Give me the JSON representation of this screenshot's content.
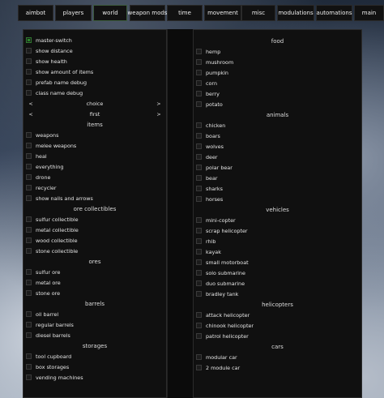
{
  "tabs": [
    "aimbot",
    "players",
    "world",
    "weapon mods",
    "time",
    "movement",
    "misc",
    "modulations",
    "automations",
    "main"
  ],
  "active_tab": "world",
  "left": [
    {
      "type": "checkbox",
      "label": "master-switch",
      "checked": true
    },
    {
      "type": "checkbox",
      "label": "show distance",
      "checked": false
    },
    {
      "type": "checkbox",
      "label": "show health",
      "checked": false
    },
    {
      "type": "checkbox",
      "label": "show amount of items",
      "checked": false
    },
    {
      "type": "checkbox",
      "label": "prefab name debug",
      "checked": false
    },
    {
      "type": "checkbox",
      "label": "class name debug",
      "checked": false
    },
    {
      "type": "select",
      "label": "choice",
      "prev": "<",
      "next": ">"
    },
    {
      "type": "select",
      "label": "first",
      "prev": "<",
      "next": ">"
    },
    {
      "type": "heading",
      "label": "items"
    },
    {
      "type": "checkbox",
      "label": "weapons",
      "checked": false
    },
    {
      "type": "checkbox",
      "label": "melee weapons",
      "checked": false
    },
    {
      "type": "checkbox",
      "label": "heal",
      "checked": false
    },
    {
      "type": "checkbox",
      "label": "everything",
      "checked": false
    },
    {
      "type": "checkbox",
      "label": "drone",
      "checked": false
    },
    {
      "type": "checkbox",
      "label": "recycler",
      "checked": false
    },
    {
      "type": "checkbox",
      "label": "show nails and arrows",
      "checked": false
    },
    {
      "type": "heading",
      "label": "ore collectibles"
    },
    {
      "type": "checkbox",
      "label": "sulfur collectible",
      "checked": false
    },
    {
      "type": "checkbox",
      "label": "metal collectible",
      "checked": false
    },
    {
      "type": "checkbox",
      "label": "wood collectible",
      "checked": false
    },
    {
      "type": "checkbox",
      "label": "stone collectible",
      "checked": false
    },
    {
      "type": "heading",
      "label": "ores"
    },
    {
      "type": "checkbox",
      "label": "sulfur ore",
      "checked": false
    },
    {
      "type": "checkbox",
      "label": "metal ore",
      "checked": false
    },
    {
      "type": "checkbox",
      "label": "stone ore",
      "checked": false
    },
    {
      "type": "heading",
      "label": "barrels"
    },
    {
      "type": "checkbox",
      "label": "oil barrel",
      "checked": false
    },
    {
      "type": "checkbox",
      "label": "regular barrels",
      "checked": false
    },
    {
      "type": "checkbox",
      "label": "diesel barrels",
      "checked": false
    },
    {
      "type": "heading",
      "label": "storages"
    },
    {
      "type": "checkbox",
      "label": "tool cupboard",
      "checked": false
    },
    {
      "type": "checkbox",
      "label": "box storages",
      "checked": false
    },
    {
      "type": "checkbox",
      "label": "vending machines",
      "checked": false
    }
  ],
  "right": [
    {
      "type": "heading",
      "label": "food"
    },
    {
      "type": "checkbox",
      "label": "hemp",
      "checked": false
    },
    {
      "type": "checkbox",
      "label": "mushroom",
      "checked": false
    },
    {
      "type": "checkbox",
      "label": "pumpkin",
      "checked": false
    },
    {
      "type": "checkbox",
      "label": "corn",
      "checked": false
    },
    {
      "type": "checkbox",
      "label": "berry",
      "checked": false
    },
    {
      "type": "checkbox",
      "label": "potato",
      "checked": false
    },
    {
      "type": "heading",
      "label": "animals"
    },
    {
      "type": "checkbox",
      "label": "chicken",
      "checked": false
    },
    {
      "type": "checkbox",
      "label": "boars",
      "checked": false
    },
    {
      "type": "checkbox",
      "label": "wolves",
      "checked": false
    },
    {
      "type": "checkbox",
      "label": "deer",
      "checked": false
    },
    {
      "type": "checkbox",
      "label": "polar bear",
      "checked": false
    },
    {
      "type": "checkbox",
      "label": "bear",
      "checked": false
    },
    {
      "type": "checkbox",
      "label": "sharks",
      "checked": false
    },
    {
      "type": "checkbox",
      "label": "horses",
      "checked": false
    },
    {
      "type": "heading",
      "label": "vehicles"
    },
    {
      "type": "checkbox",
      "label": "mini-copter",
      "checked": false
    },
    {
      "type": "checkbox",
      "label": "scrap helicopter",
      "checked": false
    },
    {
      "type": "checkbox",
      "label": "rhib",
      "checked": false
    },
    {
      "type": "checkbox",
      "label": "kayak",
      "checked": false
    },
    {
      "type": "checkbox",
      "label": "small motorboat",
      "checked": false
    },
    {
      "type": "checkbox",
      "label": "solo submarine",
      "checked": false
    },
    {
      "type": "checkbox",
      "label": "duo submarine",
      "checked": false
    },
    {
      "type": "checkbox",
      "label": "bradley tank",
      "checked": false
    },
    {
      "type": "heading",
      "label": "helicopters"
    },
    {
      "type": "checkbox",
      "label": "attack helicopter",
      "checked": false
    },
    {
      "type": "checkbox",
      "label": "chinook helicopter",
      "checked": false
    },
    {
      "type": "checkbox",
      "label": "patrol helicopter",
      "checked": false
    },
    {
      "type": "heading",
      "label": "cars"
    },
    {
      "type": "checkbox",
      "label": "modular car",
      "checked": false
    },
    {
      "type": "checkbox",
      "label": "2 module car",
      "checked": false
    }
  ]
}
